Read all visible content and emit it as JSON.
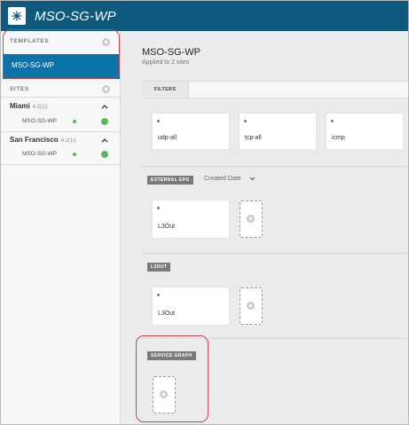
{
  "app": {
    "title": "MSO-SG-WP",
    "logo_icon": "network-logo-icon"
  },
  "sidebar": {
    "templates_label": "TEMPLATES",
    "selected_template": "MSO-SG-WP",
    "sites_label": "SITES",
    "sites": [
      {
        "name": "Miami",
        "version": "4.2(1i)",
        "template": "MSO-SG-WP",
        "status": "ok"
      },
      {
        "name": "San Francisco",
        "version": "4.2(1i)",
        "template": "MSO-SG-WP",
        "status": "ok"
      }
    ]
  },
  "main": {
    "title": "MSO-SG-WP",
    "subtitle": "Applied to 2 sites",
    "filters": {
      "tab_label": "FILTERS",
      "items": [
        "udp-all",
        "tcp-all",
        "icmp"
      ]
    },
    "external_epg": {
      "label": "EXTERNAL EPG",
      "sort_label": "Created Date",
      "items": [
        "L3Out"
      ]
    },
    "l3out": {
      "label": "L3OUT",
      "items": [
        "L3Out"
      ]
    },
    "service_graph": {
      "label": "SERVICE GRAPH"
    }
  },
  "colors": {
    "header": "#0e5a7e",
    "selected": "#0a73a8",
    "status_ok": "#5cb85c",
    "highlight": "#c8454a"
  }
}
